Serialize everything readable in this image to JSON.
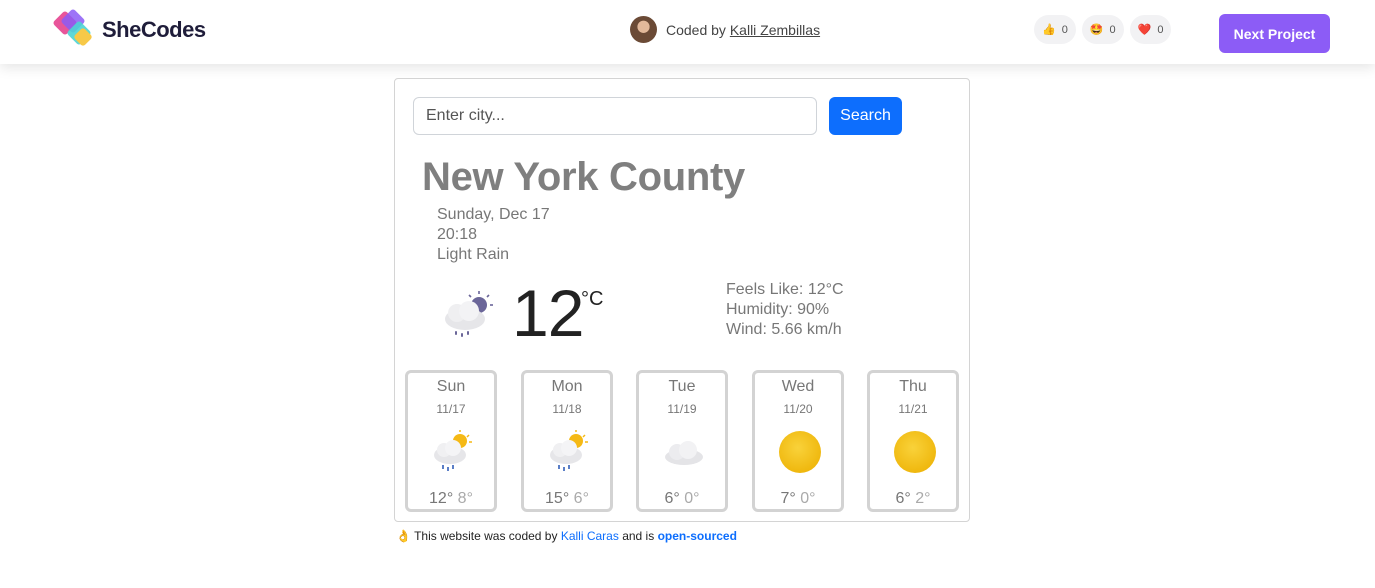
{
  "header": {
    "brand": "SheCodes",
    "coded_by_prefix": "Coded by",
    "coder_name": "Kalli Zembillas",
    "reactions": [
      {
        "icon": "thumbs-up-icon",
        "glyph": "👍",
        "count": "0"
      },
      {
        "icon": "star-struck-icon",
        "glyph": "🤩",
        "count": "0"
      },
      {
        "icon": "heart-icon",
        "glyph": "❤️",
        "count": "0"
      }
    ],
    "next_button": "Next Project",
    "accent": "#8c5cf6"
  },
  "search": {
    "placeholder": "Enter city...",
    "value": "",
    "button": "Search",
    "button_color": "#0d6efd"
  },
  "current": {
    "city": "New York County",
    "date": "Sunday, Dec 17",
    "time": "20:18",
    "description": "Light Rain",
    "icon": "night-rain-cloud-icon",
    "temperature": "12",
    "unit": "°C",
    "feels_like": "Feels Like: 12°C",
    "humidity": "Humidity: 90%",
    "wind": "Wind: 5.66 km/h"
  },
  "forecast": [
    {
      "day": "Sun",
      "date": "11/17",
      "icon": "sun-rain-cloud-icon",
      "max": "12°",
      "min": "8°"
    },
    {
      "day": "Mon",
      "date": "11/18",
      "icon": "sun-rain-cloud-icon",
      "max": "15°",
      "min": "6°"
    },
    {
      "day": "Tue",
      "date": "11/19",
      "icon": "cloud-icon",
      "max": "6°",
      "min": "0°"
    },
    {
      "day": "Wed",
      "date": "11/20",
      "icon": "sun-icon",
      "max": "7°",
      "min": "0°"
    },
    {
      "day": "Thu",
      "date": "11/21",
      "icon": "sun-icon",
      "max": "6°",
      "min": "2°"
    }
  ],
  "footer": {
    "emoji": "👌",
    "prefix": "This website was coded by",
    "author": "Kalli Caras",
    "middle": "and is",
    "link": "open-sourced"
  }
}
